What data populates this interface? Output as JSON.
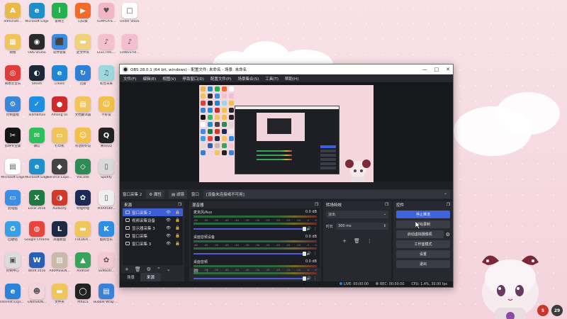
{
  "desktop": {
    "icons": [
      {
        "label": "Administr...",
        "color": "#e9b949",
        "glyph": "A"
      },
      {
        "label": "Microsoft Edge",
        "color": "#1e90c9",
        "glyph": "e"
      },
      {
        "label": "爱奇艺",
        "color": "#23b14d",
        "glyph": "i"
      },
      {
        "label": "向日葵",
        "color": "#ef6a2b",
        "glyph": "▶"
      },
      {
        "label": "TEMPLATE...",
        "color": "#f3b6c6",
        "glyph": "♥"
      },
      {
        "label": "Under Stack",
        "color": "#ffffff",
        "glyph": "□"
      },
      {
        "label": "网络",
        "color": "#f0c65c",
        "glyph": "▦"
      },
      {
        "label": "OBS Studio",
        "color": "#2a2a2a",
        "glyph": "◉"
      },
      {
        "label": "软件管家",
        "color": "#3b8be0",
        "glyph": "⬛"
      },
      {
        "label": "此文件夹",
        "color": "#f0d27a",
        "glyph": "▬"
      },
      {
        "label": "ELECTRIC...",
        "color": "#f4c0cf",
        "glyph": "♪"
      },
      {
        "label": "LOWESTRI...",
        "color": "#f4bdd0",
        "glyph": "♪"
      },
      {
        "label": "网易云音乐",
        "color": "#e23b3b",
        "glyph": "◎"
      },
      {
        "label": "Steam",
        "color": "#1b2838",
        "glyph": "◐"
      },
      {
        "label": "uTools",
        "color": "#1f85d6",
        "glyph": "e"
      },
      {
        "label": "迅雷",
        "color": "#2e7fd6",
        "glyph": "↻"
      },
      {
        "label": "初音未来",
        "color": "#9ed8df",
        "glyph": "♫"
      },
      {
        "label": "控制面板",
        "color": "#3b86d6",
        "glyph": "⚙"
      },
      {
        "label": "Teambition",
        "color": "#1f8ee0",
        "glyph": "✓"
      },
      {
        "label": "Among Us",
        "color": "#cf2b2b",
        "glyph": "●"
      },
      {
        "label": "文档翻译器",
        "color": "#f0c65c",
        "glyph": "▤"
      },
      {
        "label": "不好说",
        "color": "#f2c14a",
        "glyph": "☺"
      },
      {
        "label": "剪映专业版",
        "color": "#151515",
        "glyph": "✂"
      },
      {
        "label": "微信",
        "color": "#2dc05a",
        "glyph": "✉"
      },
      {
        "label": "打印机",
        "color": "#f0c65c",
        "glyph": "▭"
      },
      {
        "label": "有话好好说",
        "color": "#f2c14a",
        "glyph": "☺"
      },
      {
        "label": "腾讯QQ",
        "color": "#222222",
        "glyph": "Q"
      },
      {
        "label": "Microsoft Edge",
        "color": "#ffffff",
        "glyph": "▤"
      },
      {
        "label": "Microsoft Edge",
        "color": "#1e90c9",
        "glyph": "e"
      },
      {
        "label": "GeForce Experience",
        "color": "#444",
        "glyph": "◆"
      },
      {
        "label": "VSCode",
        "color": "#2e8b57",
        "glyph": "◇"
      },
      {
        "label": "Spotify",
        "color": "#d9d9d9",
        "glyph": "▯"
      },
      {
        "label": "此电脑",
        "color": "#3a8ee6",
        "glyph": "▭"
      },
      {
        "label": "Excel 2016",
        "color": "#1d7a45",
        "glyph": "X"
      },
      {
        "label": "Audacity",
        "color": "#d13a2a",
        "glyph": "◑"
      },
      {
        "label": "哔哩哔哩",
        "color": "#1d2a55",
        "glyph": "✿"
      },
      {
        "label": "PIXARSKY...",
        "color": "#efefef",
        "glyph": "▯"
      },
      {
        "label": "回收站",
        "color": "#3aa0e6",
        "glyph": "♻"
      },
      {
        "label": "Google Chrome",
        "color": "#e8453c",
        "glyph": "◍"
      },
      {
        "label": "英雄联盟",
        "color": "#1c2a44",
        "glyph": "L"
      },
      {
        "label": "FOLDER...",
        "color": "#f0c65c",
        "glyph": "▬"
      },
      {
        "label": "酷狗音乐",
        "color": "#2f8fe5",
        "glyph": "K"
      },
      {
        "label": "控制中心",
        "color": "#dcdcdc",
        "glyph": "▣"
      },
      {
        "label": "Word 2016",
        "color": "#2a5fb6",
        "glyph": "W"
      },
      {
        "label": "AIRPASSEN...",
        "color": "#c8b9a8",
        "glyph": "▧"
      },
      {
        "label": "Android",
        "color": "#3aa35a",
        "glyph": "▲"
      },
      {
        "label": "SENSOR...",
        "color": "#f4c9d4",
        "glyph": "✿"
      },
      {
        "label": "Internet Explorer",
        "color": "#2c82d6",
        "glyph": "e"
      },
      {
        "label": "ENVISION...",
        "color": "#f2d4dc",
        "glyph": "☻"
      },
      {
        "label": "文件夹",
        "color": "#f0c65c",
        "glyph": "▬"
      },
      {
        "label": "PIXELS",
        "color": "#222",
        "glyph": "◯"
      },
      {
        "label": "Bubble Wrap Words",
        "color": "#3b82d6",
        "glyph": "▤"
      }
    ]
  },
  "obs": {
    "title": "OBS 28.0.1 (64 bit, windows) - 配置文件: 未命名 - 场景: 未命名",
    "window_controls": [
      "—",
      "□",
      "✕"
    ],
    "menu": [
      "文件(F)",
      "编辑(E)",
      "视图(V)",
      "停靠窗口(D)",
      "配置文件(P)",
      "场景集合(S)",
      "工具(T)",
      "帮助(H)"
    ],
    "source_bar": {
      "name": "窗口采集 2",
      "props": "属性",
      "filters": "滤镜",
      "window_label": "窗口",
      "window_value": "[设备未连接或不可用]"
    },
    "sources": {
      "title": "来源",
      "items": [
        {
          "label": "窗口采集 2",
          "selected": true
        },
        {
          "label": "视频采集设备",
          "selected": false
        },
        {
          "label": "显示器采集 3",
          "selected": false
        },
        {
          "label": "窗口采集",
          "selected": false
        },
        {
          "label": "窗口采集 3",
          "selected": false
        }
      ],
      "tabs": [
        "场景",
        "来源"
      ]
    },
    "mixer": {
      "title": "混音器",
      "channels": [
        {
          "name": "麦克风/Aux",
          "db": "0.0 dB"
        },
        {
          "name": "桌面音频设备",
          "db": "0.0 dB"
        },
        {
          "name": "桌面音频",
          "db": "0.0 dB"
        }
      ],
      "scale": [
        "-60",
        "-55",
        "-50",
        "-45",
        "-40",
        "-35",
        "-30",
        "-25",
        "-20",
        "-15",
        "-10",
        "-5",
        "0"
      ]
    },
    "transitions": {
      "title": "转场特效",
      "type": "淡出",
      "duration_label": "时长",
      "duration_value": "300 ms"
    },
    "controls": {
      "title": "控件",
      "buttons": [
        "停止推流",
        "开始录制",
        "启动虚拟摄像机",
        "工作室模式",
        "设置",
        "退出"
      ]
    },
    "status": {
      "live": "LIVE: 00:00:00",
      "rec": "REC: 00:00:00",
      "cpu": "CPU: 1.4%, 30.00 fps"
    },
    "accent": "#3f63dd"
  },
  "tray": {
    "badge": "29"
  }
}
